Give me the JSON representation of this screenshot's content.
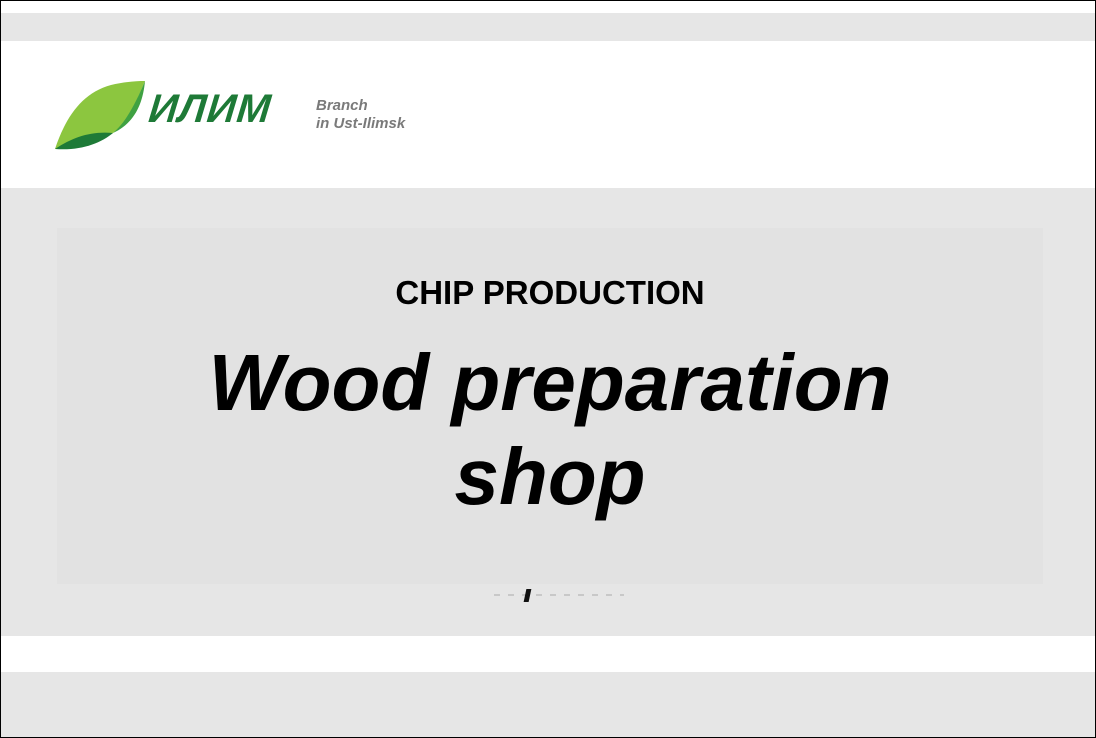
{
  "logo": {
    "wordmark": "ИЛИМ",
    "subtitle_line1": "Branch",
    "subtitle_line2": "in Ust-Ilimsk",
    "leaf_light_color": "#8cc63f",
    "leaf_dark_color": "#1e7a37",
    "wordmark_color": "#1e7a37"
  },
  "slide": {
    "subtitle": "CHIP PRODUCTION",
    "title_line1": "Wood preparation",
    "title_line2": "shop"
  }
}
